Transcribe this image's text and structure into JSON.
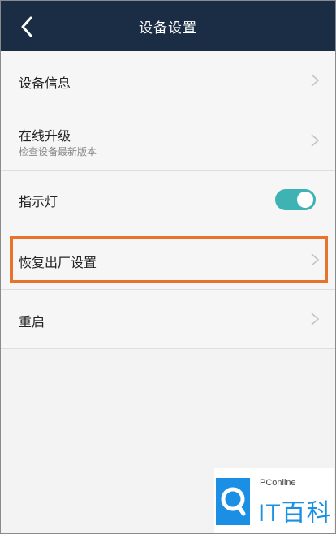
{
  "header": {
    "title": "设备设置",
    "back_icon": "chevron-left-icon"
  },
  "settings": {
    "items": [
      {
        "label": "设备信息"
      },
      {
        "label": "在线升级",
        "sublabel": "检查设备最新版本"
      },
      {
        "label": "指示灯",
        "toggle_on": true
      },
      {
        "label": "恢复出厂设置"
      },
      {
        "label": "重启"
      }
    ]
  },
  "watermark": {
    "small": "PConline",
    "big": "IT百科"
  },
  "colors": {
    "header_bg": "#1b2c45",
    "toggle_on": "#3fb3b3",
    "highlight": "#e8742c",
    "brand_blue": "#1a8fe3"
  }
}
